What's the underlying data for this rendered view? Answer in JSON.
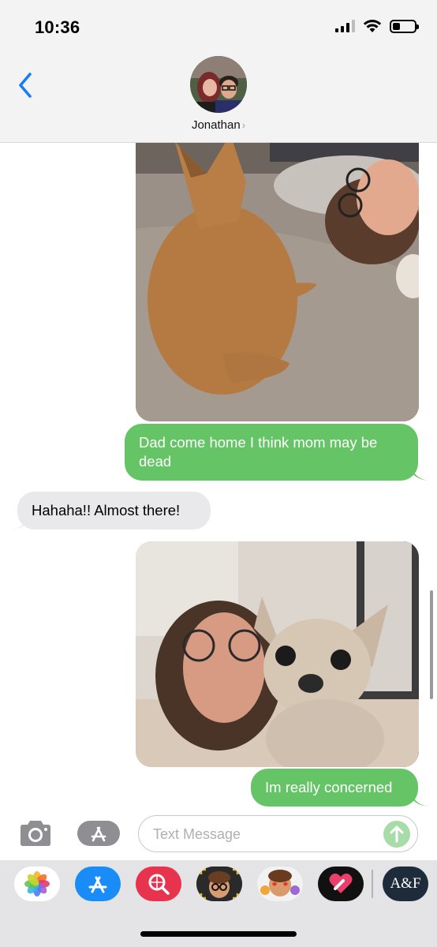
{
  "status_bar": {
    "time": "10:36",
    "icons": [
      "cellular-signal-icon",
      "wifi-icon",
      "battery-icon"
    ],
    "battery_level": 0.35
  },
  "header": {
    "back_icon": "chevron-left-icon",
    "contact_name": "Jonathan",
    "contact_chevron": "›"
  },
  "messages": [
    {
      "type": "image",
      "direction": "outgoing",
      "description_icon": "photo-dog-and-woman-on-couch"
    },
    {
      "type": "text",
      "direction": "outgoing",
      "text": "Dad come home I think mom may be dead"
    },
    {
      "type": "text",
      "direction": "incoming",
      "text": "Hahaha!! Almost there!"
    },
    {
      "type": "image",
      "direction": "outgoing",
      "description_icon": "photo-woman-with-chihuahua"
    },
    {
      "type": "text",
      "direction": "outgoing",
      "text": "Im really concerned"
    }
  ],
  "input": {
    "placeholder": "Text Message",
    "value": ""
  },
  "app_drawer": {
    "apps": [
      {
        "name": "photos-app-icon"
      },
      {
        "name": "app-store-icon"
      },
      {
        "name": "image-search-icon"
      },
      {
        "name": "memoji-icon"
      },
      {
        "name": "animoji-stickers-icon"
      },
      {
        "name": "digital-touch-heart-icon"
      },
      {
        "name": "af-app-icon",
        "label": "A&F"
      }
    ]
  },
  "colors": {
    "outgoing_bubble": "#65c466",
    "incoming_bubble": "#e9e9eb",
    "accent_blue": "#1a7cf5",
    "header_bg": "#f3f3f3"
  }
}
